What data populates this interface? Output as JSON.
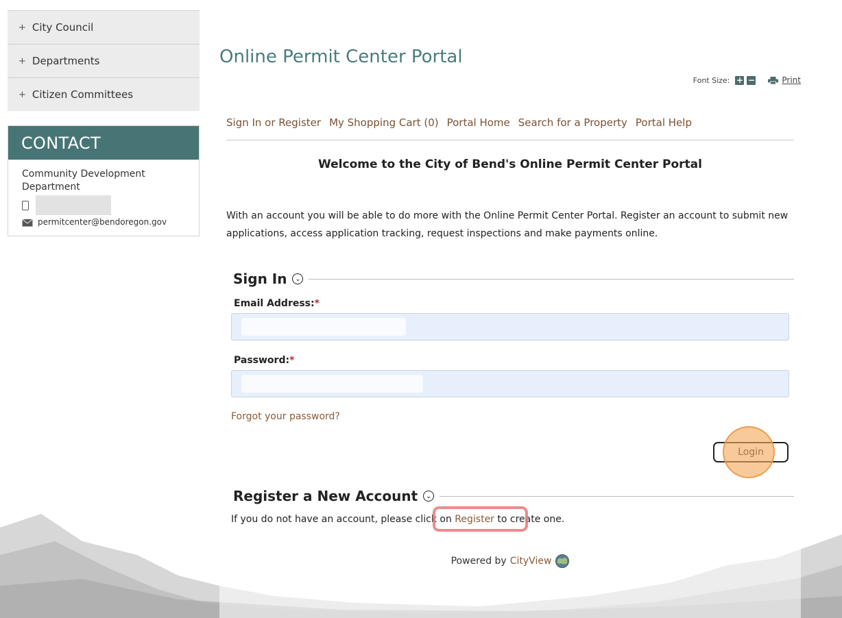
{
  "sidebar": {
    "nav": [
      {
        "label": "City Council",
        "prefix": "+"
      },
      {
        "label": "Departments",
        "prefix": "+"
      },
      {
        "label": "Citizen Committees",
        "prefix": "+"
      }
    ],
    "contact": {
      "heading": "CONTACT",
      "department": "Community Development Department",
      "email": "permitcenter@bendoregon.gov"
    }
  },
  "page": {
    "title": "Online Permit Center Portal",
    "font_size_label": "Font Size:",
    "font_increase": "+",
    "font_decrease": "−",
    "print_label": "Print"
  },
  "topnav": {
    "items": [
      "Sign In or Register",
      "My Shopping Cart (0)",
      "Portal Home",
      "Search for a Property",
      "Portal Help"
    ]
  },
  "welcome": "Welcome to the City of Bend's Online Permit Center Portal",
  "intro": "With an account you will be able to do more with the Online Permit Center Portal. Register an account to submit new applications, access application tracking, request inspections and make payments online.",
  "signin": {
    "title": "Sign In",
    "email_label": "Email Address:",
    "password_label": "Password:",
    "required_mark": "*",
    "forgot": "Forgot your password?",
    "login_button": "Login"
  },
  "register": {
    "title": "Register a New Account",
    "text_before": "If you do not have an account, please click on ",
    "link": "Register",
    "text_after": " to create one."
  },
  "footer": {
    "powered_by": "Powered by",
    "brand": "CityView"
  },
  "colors": {
    "accent": "#477575",
    "title": "#4a7c7c",
    "link": "#8a5a35",
    "field_bg": "#e8effc"
  }
}
